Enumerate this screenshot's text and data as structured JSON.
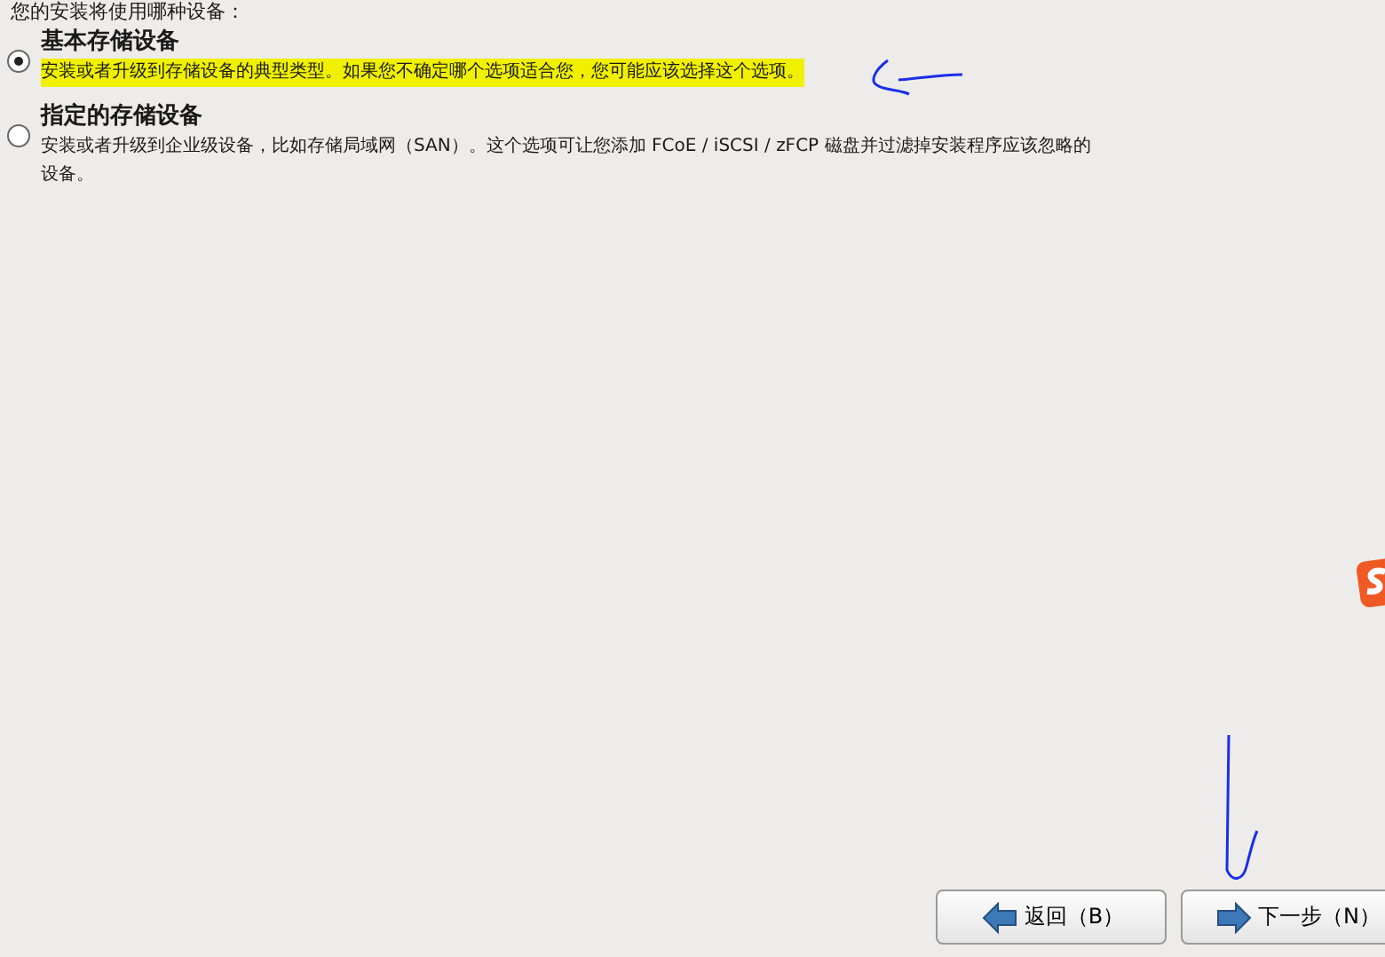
{
  "prompt": "您的安装将使用哪种设备：",
  "options": [
    {
      "title": "基本存储设备",
      "description": "安装或者升级到存储设备的典型类型。如果您不确定哪个选项适合您，您可能应该选择这个选项。",
      "selected": true,
      "highlighted": true
    },
    {
      "title": "指定的存储设备",
      "description": "安装或者升级到企业级设备，比如存储局域网（SAN）。这个选项可让您添加 FCoE / iSCSI / zFCP 磁盘并过滤掉安装程序应该忽略的设备。",
      "selected": false,
      "highlighted": false
    }
  ],
  "buttons": [
    {
      "label": "返回（B）",
      "kind": "back"
    },
    {
      "label": "下一步（N）",
      "kind": "next"
    }
  ]
}
